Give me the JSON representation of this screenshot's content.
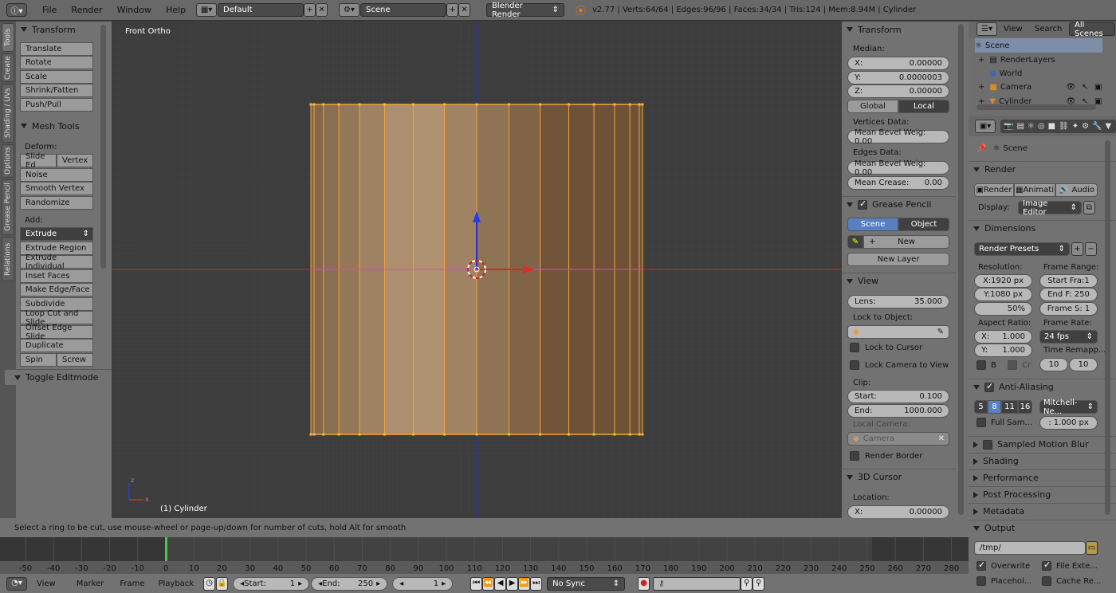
{
  "topbar": {
    "menus": [
      "File",
      "Render",
      "Window",
      "Help"
    ],
    "screen_layout": "Default",
    "scene": "Scene",
    "render_engine": "Blender Render",
    "stats": "v2.77 | Verts:64/64 | Edges:96/96 | Faces:34/34 | Tris:124 | Mem:8.94M | Cylinder"
  },
  "tabs": [
    "Tools",
    "Create",
    "Shading / UVs",
    "Options",
    "Grease Pencil",
    "Relations"
  ],
  "toolshelf": {
    "transform_header": "Transform",
    "transform_buttons": [
      "Translate",
      "Rotate",
      "Scale",
      "Shrink/Fatten",
      "Push/Pull"
    ],
    "mesh_tools_header": "Mesh Tools",
    "deform_label": "Deform:",
    "slide_edge": "Slide Ed",
    "vertex": "Vertex",
    "noise": "Noise",
    "smooth_vertex": "Smooth Vertex",
    "randomize": "Randomize",
    "add_label": "Add:",
    "extrude_select": "Extrude",
    "add_buttons": [
      "Extrude Region",
      "Extrude Individual",
      "Inset Faces",
      "Make Edge/Face",
      "Subdivide",
      "Loop Cut and Slide",
      "Offset Edge Slide",
      "Duplicate"
    ],
    "spin": "Spin",
    "screw": "Screw",
    "toggle_editmode": "Toggle Editmode"
  },
  "viewport": {
    "view_name": "Front Ortho",
    "object_label": "(1) Cylinder",
    "axis_x": "x",
    "axis_z": "z"
  },
  "npanel": {
    "transform_header": "Transform",
    "median_label": "Median:",
    "x_label": "X:",
    "x_value": "0.00000",
    "y_label": "Y:",
    "y_value": "0.0000003",
    "z_label": "Z:",
    "z_value": "0.00000",
    "global": "Global",
    "local": "Local",
    "vertices_data": "Vertices Data:",
    "mean_bevel_weight_v": "Mean Bevel Weig: 0.00",
    "edges_data": "Edges Data:",
    "mean_bevel_weight_e": "Mean Bevel Weig: 0.00",
    "mean_crease_label": "Mean Crease:",
    "mean_crease_value": "0.00",
    "grease_pencil_header": "Grease Pencil",
    "gp_scene": "Scene",
    "gp_object": "Object",
    "new": "New",
    "new_layer": "New Layer",
    "view_header": "View",
    "lens_label": "Lens:",
    "lens_value": "35.000",
    "lock_to_object": "Lock to Object:",
    "lock_to_cursor": "Lock to Cursor",
    "lock_camera_to_view": "Lock Camera to View",
    "clip_label": "Clip:",
    "start_label": "Start:",
    "start_value": "0.100",
    "end_label": "End:",
    "end_value": "1000.000",
    "local_camera": "Local Camera:",
    "camera_field": "Camera",
    "render_border": "Render Border",
    "cursor_header": "3D Cursor",
    "location_label": "Location:",
    "cursor_x_label": "X:",
    "cursor_x_value": "0.00000"
  },
  "outliner": {
    "view": "View",
    "search": "Search",
    "all_scenes": "All Scenes",
    "items": [
      "Scene",
      "RenderLayers",
      "World",
      "Camera",
      "Cylinder"
    ]
  },
  "properties": {
    "scene": "Scene",
    "render_header": "Render",
    "render_btn": "Render",
    "animation_btn": "Animati",
    "audio_btn": "Audio",
    "display_label": "Display:",
    "display_value": "Image Editor",
    "dimensions_header": "Dimensions",
    "render_presets": "Render Presets",
    "resolution_label": "Resolution:",
    "res_x": "X:1920 px",
    "res_y": "Y:1080 px",
    "res_pct": "50%",
    "frame_range_label": "Frame Range:",
    "start_frame": "Start Fra:1",
    "end_frame": "End F: 250",
    "frame_step": "Frame S: 1",
    "aspect_ratio_label": "Aspect Ratio:",
    "aspect_x_label": "X:",
    "aspect_x_value": "1.000",
    "aspect_y_label": "Y:",
    "aspect_y_value": "1.000",
    "frame_rate_label": "Frame Rate:",
    "frame_rate": "24 fps",
    "time_remap_label": "Time Remapp...",
    "remap_old": "10",
    "remap_new": "10",
    "b_label": "B",
    "cr_label": "Cr",
    "aa_header": "Anti-Aliasing",
    "aa_samples": [
      "5",
      "8",
      "11",
      "16"
    ],
    "aa_filter": "Mitchell-Ne...",
    "full_sample": "Full Sam...",
    "filter_size": ": 1.000 px",
    "motion_blur": "Sampled Motion Blur",
    "shading": "Shading",
    "performance": "Performance",
    "post_processing": "Post Processing",
    "metadata": "Metadata",
    "output_header": "Output",
    "output_path": "/tmp/",
    "overwrite": "Overwrite",
    "file_extensions": "File Exte...",
    "placeholders": "Placehol...",
    "cache_result": "Cache Re..."
  },
  "status": {
    "text": "Select a ring to be cut, use mouse-wheel or page-up/down for number of cuts, hold Alt for smooth"
  },
  "timeline": {
    "ticks": [
      "-50",
      "-40",
      "-30",
      "-20",
      "-10",
      "0",
      "10",
      "20",
      "30",
      "40",
      "50",
      "60",
      "70",
      "80",
      "90",
      "100",
      "110",
      "120",
      "130",
      "140",
      "150",
      "160",
      "170",
      "180",
      "190",
      "200",
      "210",
      "220",
      "230",
      "240",
      "250",
      "260",
      "270",
      "280"
    ],
    "current_frame": 0,
    "view": "View",
    "marker": "Marker",
    "frame": "Frame",
    "playback": "Playback",
    "start_label": "Start:",
    "start_value": "1",
    "end_label": "End:",
    "end_value": "250",
    "current_value": "1",
    "sync": "No Sync"
  },
  "colors": {
    "selected_orange": "#f3a23c",
    "x_axis": "#c8252a",
    "z_axis": "#2a2ad0",
    "active_blue": "#5680c2",
    "playhead": "#4ac84a"
  }
}
